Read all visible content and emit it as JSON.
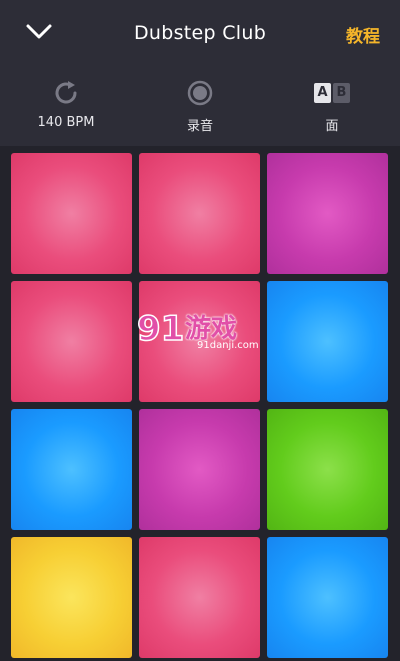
{
  "header": {
    "title": "Dubstep Club",
    "tutorial_label": "教程"
  },
  "toolbar": {
    "bpm_label": "140 BPM",
    "record_label": "录音",
    "ab_label": "面",
    "ab_a": "A",
    "ab_b": "B"
  },
  "pads": [
    {
      "color": "pink"
    },
    {
      "color": "pink"
    },
    {
      "color": "purple"
    },
    {
      "color": "pink"
    },
    {
      "color": "pink"
    },
    {
      "color": "blue"
    },
    {
      "color": "blue"
    },
    {
      "color": "purple"
    },
    {
      "color": "green"
    },
    {
      "color": "yellow"
    },
    {
      "color": "pink"
    },
    {
      "color": "blue"
    }
  ],
  "watermark": {
    "logo_text": "游戏",
    "site": "91danji.com"
  }
}
